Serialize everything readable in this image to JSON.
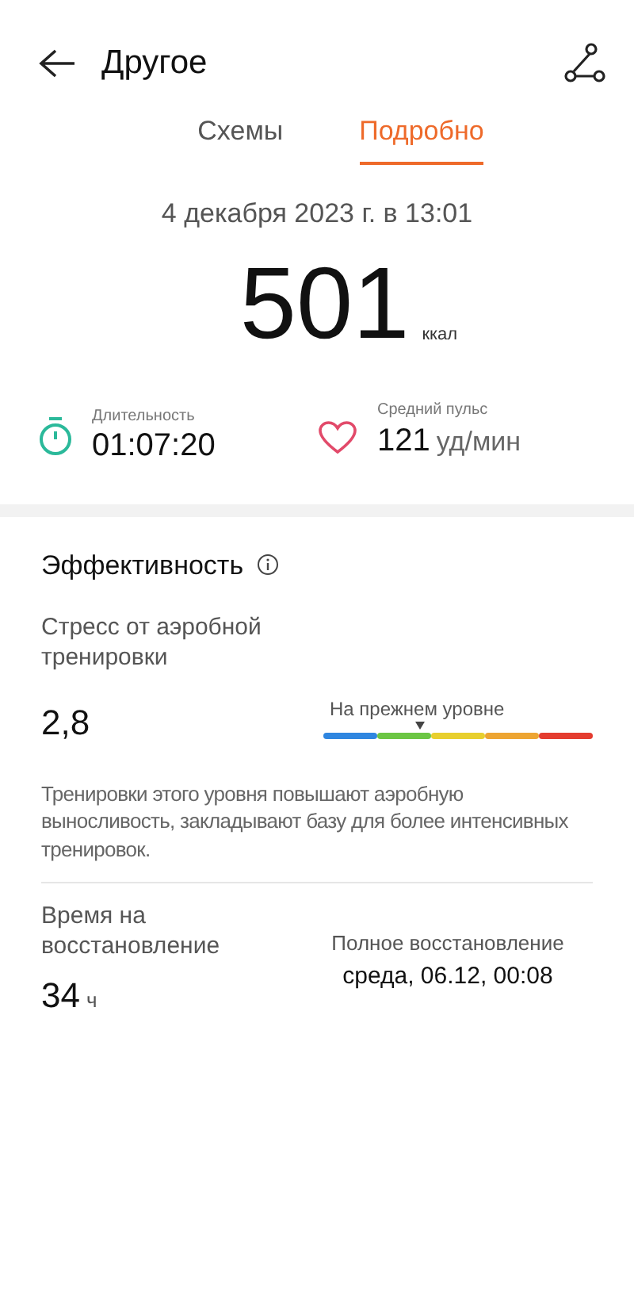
{
  "header": {
    "title": "Другое"
  },
  "tabs": [
    {
      "label": "Схемы",
      "selected": false
    },
    {
      "label": "Подробно",
      "selected": true
    }
  ],
  "date": "4 декабря 2023 г. в 13:01",
  "calories": {
    "value": "501",
    "unit": "ккал"
  },
  "stats": [
    {
      "kind": "duration",
      "label": "Длительность",
      "value": "01:07:20"
    },
    {
      "kind": "heart",
      "label": "Средний пульс",
      "value": "121",
      "unit": "уд/мин"
    }
  ],
  "efficiency": {
    "title": "Эффективность",
    "stress": {
      "label": "Стресс от аэробной тренировки",
      "value": "2,8",
      "scale_label": "На прежнем уровне",
      "segments": [
        {
          "color": "#2f86e0"
        },
        {
          "color": "#6cc644"
        },
        {
          "color": "#e8cf2e"
        },
        {
          "color": "#eda532"
        },
        {
          "color": "#e43c2f"
        }
      ]
    },
    "description": "Тренировки этого уровня повышают аэробную выносливость, закладывают базу для более интенсивных тренировок.",
    "recovery": {
      "label": "Время на восстановление",
      "value": "34",
      "unit": "ч",
      "full_label": "Полное восстановление",
      "full_value": "среда, 06.12, 00:08"
    }
  }
}
